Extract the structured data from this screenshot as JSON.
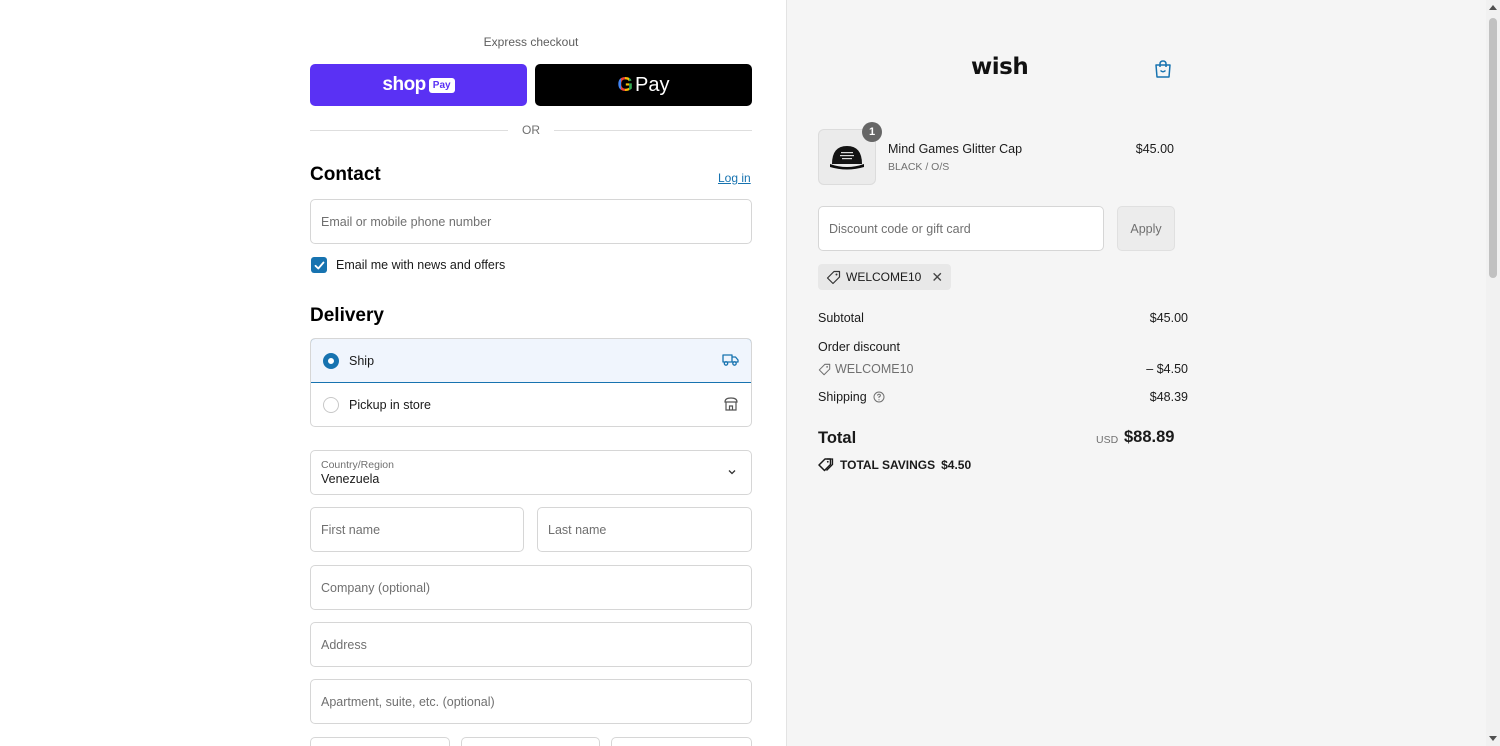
{
  "express": {
    "label": "Express checkout",
    "shop_pay": {
      "word": "shop",
      "tag": "Pay"
    },
    "gpay": {
      "g": "G",
      "word": "Pay"
    },
    "or": "OR"
  },
  "contact": {
    "title": "Contact",
    "login": "Log in",
    "email_placeholder": "Email or mobile phone number",
    "news_checkbox": "Email me with news and offers",
    "news_checked": true
  },
  "delivery": {
    "title": "Delivery",
    "options": [
      {
        "label": "Ship",
        "selected": true,
        "icon": "truck-icon"
      },
      {
        "label": "Pickup in store",
        "selected": false,
        "icon": "store-icon"
      }
    ]
  },
  "address": {
    "country_label": "Country/Region",
    "country_value": "Venezuela",
    "first_name_placeholder": "First name",
    "last_name_placeholder": "Last name",
    "company_placeholder": "Company (optional)",
    "address_placeholder": "Address",
    "apartment_placeholder": "Apartment, suite, etc. (optional)"
  },
  "summary": {
    "logo": "wish",
    "product": {
      "name": "Mind Games Glitter Cap",
      "variant": "BLACK / O/S",
      "price": "$45.00",
      "quantity": "1"
    },
    "discount_placeholder": "Discount code or gift card",
    "apply": "Apply",
    "applied_code": "WELCOME10",
    "subtotal_label": "Subtotal",
    "subtotal_value": "$45.00",
    "order_discount_label": "Order discount",
    "order_discount_code": "WELCOME10",
    "order_discount_value": "– $4.50",
    "shipping_label": "Shipping",
    "shipping_value": "$48.39",
    "total_label": "Total",
    "currency": "USD",
    "total_value": "$88.89",
    "savings_label": "TOTAL SAVINGS",
    "savings_value": "$4.50"
  },
  "colors": {
    "shop_pay": "#5a31f4",
    "accent": "#1773b0",
    "summary_bg": "#f5f5f5"
  }
}
